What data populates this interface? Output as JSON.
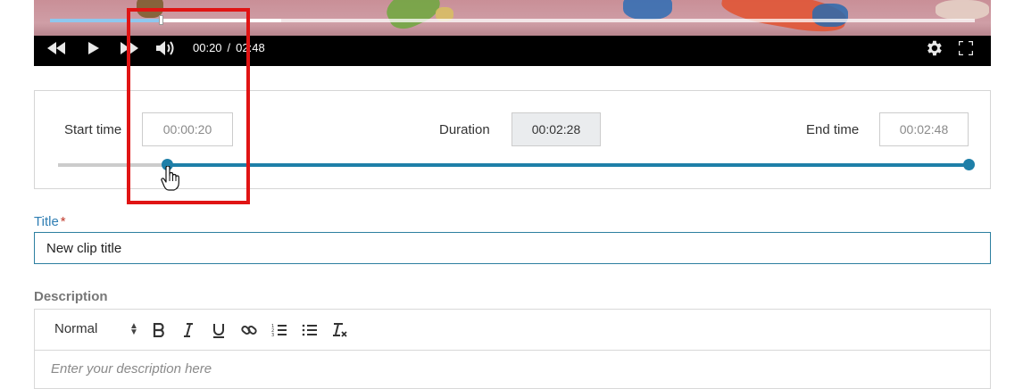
{
  "player": {
    "current_time": "00:20",
    "separator": "/",
    "total_time": "02:48",
    "played_fraction": 0.12,
    "buffered_fraction": 0.25,
    "accent_color": "#8ec7ef",
    "icons": [
      "rewind-icon",
      "play-icon",
      "fast-forward-icon",
      "volume-icon",
      "settings-icon",
      "fullscreen-icon"
    ]
  },
  "trim": {
    "start_label": "Start time",
    "start_value": "00:00:20",
    "duration_label": "Duration",
    "duration_value": "00:02:28",
    "end_label": "End time",
    "end_value": "00:02:48",
    "range_start_fraction": 0.12,
    "range_end_fraction": 1.0,
    "track_color": "#1e7fa8",
    "inactive_track_color": "#cccccc"
  },
  "title_field": {
    "label": "Title",
    "required_marker": "*",
    "value": "New clip title"
  },
  "description": {
    "label": "Description",
    "format_select": "Normal",
    "placeholder": "Enter your description here",
    "toolbar_icons": [
      "bold-icon",
      "italic-icon",
      "underline-icon",
      "link-icon",
      "ordered-list-icon",
      "bullet-list-icon",
      "clear-format-icon"
    ]
  },
  "annotation": {
    "highlight_color": "#e01414"
  }
}
